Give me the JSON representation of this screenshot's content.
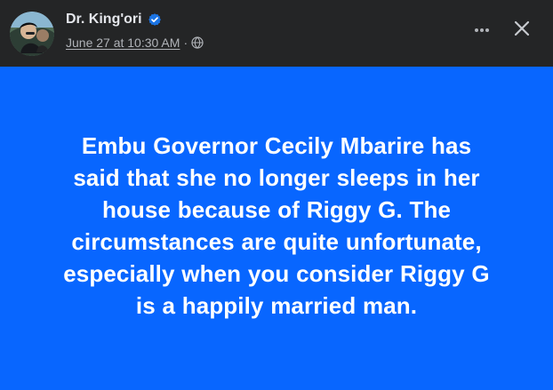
{
  "post": {
    "author_name": "Dr. King'ori",
    "timestamp": "June 27 at 10:30 AM",
    "separator": "·",
    "audience_icon": "globe-icon",
    "verified_icon": "verified-badge-icon",
    "more_icon": "more-horizontal-icon",
    "close_icon": "close-icon",
    "background_color": "#0866ff",
    "text_lines": [
      "Embu Governor Cecily Mbarire has",
      "said that she no longer sleeps in her",
      "house because of Riggy G. The",
      "circumstances are quite unfortunate,",
      "especially when you consider Riggy G",
      "is a happily married man."
    ]
  }
}
